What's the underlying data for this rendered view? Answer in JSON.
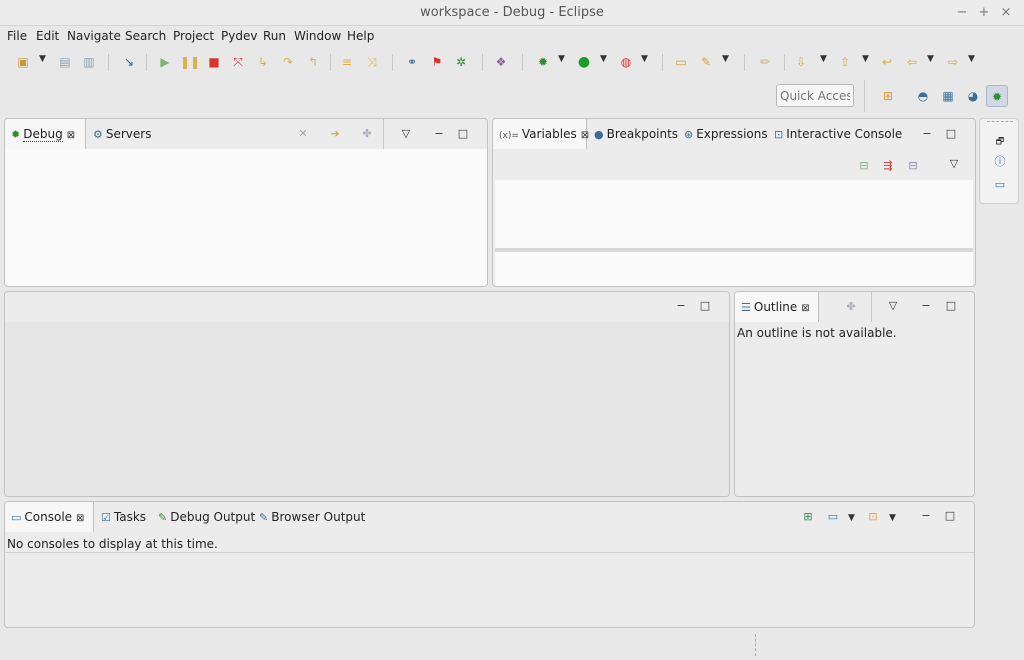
{
  "window": {
    "title": "workspace - Debug - Eclipse",
    "controls": {
      "minimize": "−",
      "maximize": "+",
      "close": "×"
    }
  },
  "menu": [
    "File",
    "Edit",
    "Navigate",
    "Search",
    "Project",
    "Pydev",
    "Run",
    "Window",
    "Help"
  ],
  "quick_access": {
    "placeholder": "Quick Access"
  },
  "debug_panel": {
    "tabs": [
      {
        "label": "Debug",
        "icon": "bug-icon",
        "active": true,
        "closeable": true
      },
      {
        "label": "Servers",
        "icon": "servers-icon",
        "active": false
      }
    ]
  },
  "variables_panel": {
    "tabs": [
      {
        "label": "Variables",
        "prefix": "(x)=",
        "active": true,
        "closeable": true
      },
      {
        "label": "Breakpoints",
        "icon": "breakpoint-icon",
        "active": false
      },
      {
        "label": "Expressions",
        "icon": "expressions-icon",
        "active": false
      },
      {
        "label": "Interactive Console",
        "icon": "console-icon",
        "active": false
      }
    ]
  },
  "outline_panel": {
    "tab": {
      "label": "Outline",
      "icon": "outline-icon",
      "closeable": true
    },
    "message": "An outline is not available."
  },
  "console_panel": {
    "tabs": [
      {
        "label": "Console",
        "icon": "console-icon",
        "active": true,
        "closeable": true
      },
      {
        "label": "Tasks",
        "icon": "tasks-icon",
        "active": false
      },
      {
        "label": "Debug Output",
        "icon": "debug-output-icon",
        "active": false
      },
      {
        "label": "Browser Output",
        "icon": "browser-output-icon",
        "active": false
      }
    ],
    "message": "No consoles to display at this time."
  },
  "colors": {
    "accent_green": "#2e8b2e",
    "run_green": "#1c9a2a",
    "stop_red": "#d9342b",
    "link_blue": "#2a5db0",
    "orange": "#e8a020"
  }
}
